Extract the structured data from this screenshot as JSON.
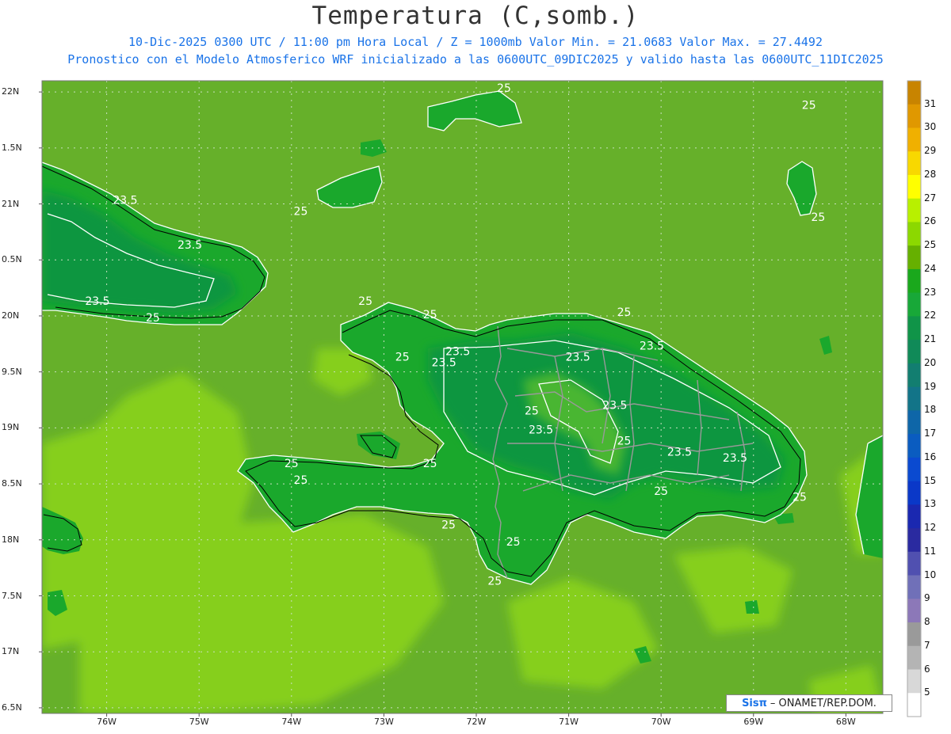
{
  "title": "Temperatura (C,somb.)",
  "subtitle1": "10-Dic-2025 0300 UTC / 11:00 pm Hora Local / Z = 1000mb  Valor Min. = 21.0683  Valor Max. = 27.4492",
  "subtitle2": "Pronostico con el Modelo Atmosferico WRF inicializado a las 0600UTC_09DIC2025 y valido hasta las  0600UTC_11DIC2025",
  "credit": {
    "brand": "Sisπ",
    "text": "– ONAMET/REP.DOM."
  },
  "colors": {
    "sea_base": "#66b02a",
    "sea_light": "#86cf1e",
    "land_base": "#1aa82c",
    "land_dark": "#0d9641",
    "land_light": "#48b630",
    "outline": "#ffffff",
    "coast": "#000000",
    "border": "#999999"
  },
  "chart_data": {
    "type": "heatmap",
    "variable": "Temperatura (C,somb.)",
    "x_ticks": [
      "76W",
      "75W",
      "74W",
      "73W",
      "72W",
      "71W",
      "70W",
      "69W",
      "68W"
    ],
    "y_ticks": [
      "22N",
      "1.5N",
      "21N",
      "0.5N",
      "20N",
      "9.5N",
      "19N",
      "8.5N",
      "18N",
      "7.5N",
      "17N",
      "6.5N"
    ],
    "xlim": [
      -76.7,
      -67.6
    ],
    "ylim": [
      16.45,
      22.1
    ],
    "colorbar": [
      "31",
      "30",
      "29",
      "28",
      "27",
      "26",
      "25",
      "24",
      "23",
      "22",
      "21",
      "20",
      "19",
      "18",
      "17",
      "16",
      "15",
      "13",
      "12",
      "11",
      "10",
      "9",
      "8",
      "7",
      "6",
      "5"
    ],
    "colorbar_colors": [
      "#c88400",
      "#e09800",
      "#f0b000",
      "#f8d800",
      "#ffff00",
      "#b8f000",
      "#8cd800",
      "#66b000",
      "#1aa81c",
      "#18a838",
      "#109448",
      "#108a58",
      "#127e70",
      "#127488",
      "#0e66a8",
      "#0a5cc0",
      "#0a4ad0",
      "#0a38c8",
      "#1a28b0",
      "#2a2aa0",
      "#5050b0",
      "#7070b8",
      "#8c78b8",
      "#9a9a9a",
      "#b4b4b4",
      "#d8d8d8",
      "#ffffff"
    ],
    "contour_labels": [
      {
        "text": "25",
        "lon": -73.9,
        "lat": 20.9
      },
      {
        "text": "23.5",
        "lon": -75.8,
        "lat": 21.0
      },
      {
        "text": "23.5",
        "lon": -75.1,
        "lat": 20.6
      },
      {
        "text": "23.5",
        "lon": -76.1,
        "lat": 20.1
      },
      {
        "text": "25",
        "lon": -75.5,
        "lat": 19.95
      },
      {
        "text": "25",
        "lon": -73.2,
        "lat": 20.1
      },
      {
        "text": "25",
        "lon": -71.7,
        "lat": 22.0
      },
      {
        "text": "25",
        "lon": -68.4,
        "lat": 21.85
      },
      {
        "text": "25",
        "lon": -68.3,
        "lat": 20.85
      },
      {
        "text": "25",
        "lon": -72.5,
        "lat": 19.98
      },
      {
        "text": "25",
        "lon": -72.8,
        "lat": 19.6
      },
      {
        "text": "23.5",
        "lon": -72.2,
        "lat": 19.65
      },
      {
        "text": "23.5",
        "lon": -72.35,
        "lat": 19.55
      },
      {
        "text": "25",
        "lon": -70.4,
        "lat": 20.0
      },
      {
        "text": "23.5",
        "lon": -70.1,
        "lat": 19.7
      },
      {
        "text": "23.5",
        "lon": -70.9,
        "lat": 19.6
      },
      {
        "text": "23.5",
        "lon": -70.5,
        "lat": 19.17
      },
      {
        "text": "25",
        "lon": -71.4,
        "lat": 19.12
      },
      {
        "text": "23.5",
        "lon": -71.3,
        "lat": 18.95
      },
      {
        "text": "25",
        "lon": -70.4,
        "lat": 18.85
      },
      {
        "text": "23.5",
        "lon": -69.8,
        "lat": 18.75
      },
      {
        "text": "23.5",
        "lon": -69.2,
        "lat": 18.7
      },
      {
        "text": "25",
        "lon": -74.0,
        "lat": 18.65
      },
      {
        "text": "25",
        "lon": -73.9,
        "lat": 18.5
      },
      {
        "text": "25",
        "lon": -72.5,
        "lat": 18.65
      },
      {
        "text": "25",
        "lon": -72.3,
        "lat": 18.1
      },
      {
        "text": "25",
        "lon": -71.6,
        "lat": 17.95
      },
      {
        "text": "25",
        "lon": -70.0,
        "lat": 18.4
      },
      {
        "text": "25",
        "lon": -68.5,
        "lat": 18.35
      },
      {
        "text": "25",
        "lon": -71.8,
        "lat": 17.6
      }
    ]
  }
}
